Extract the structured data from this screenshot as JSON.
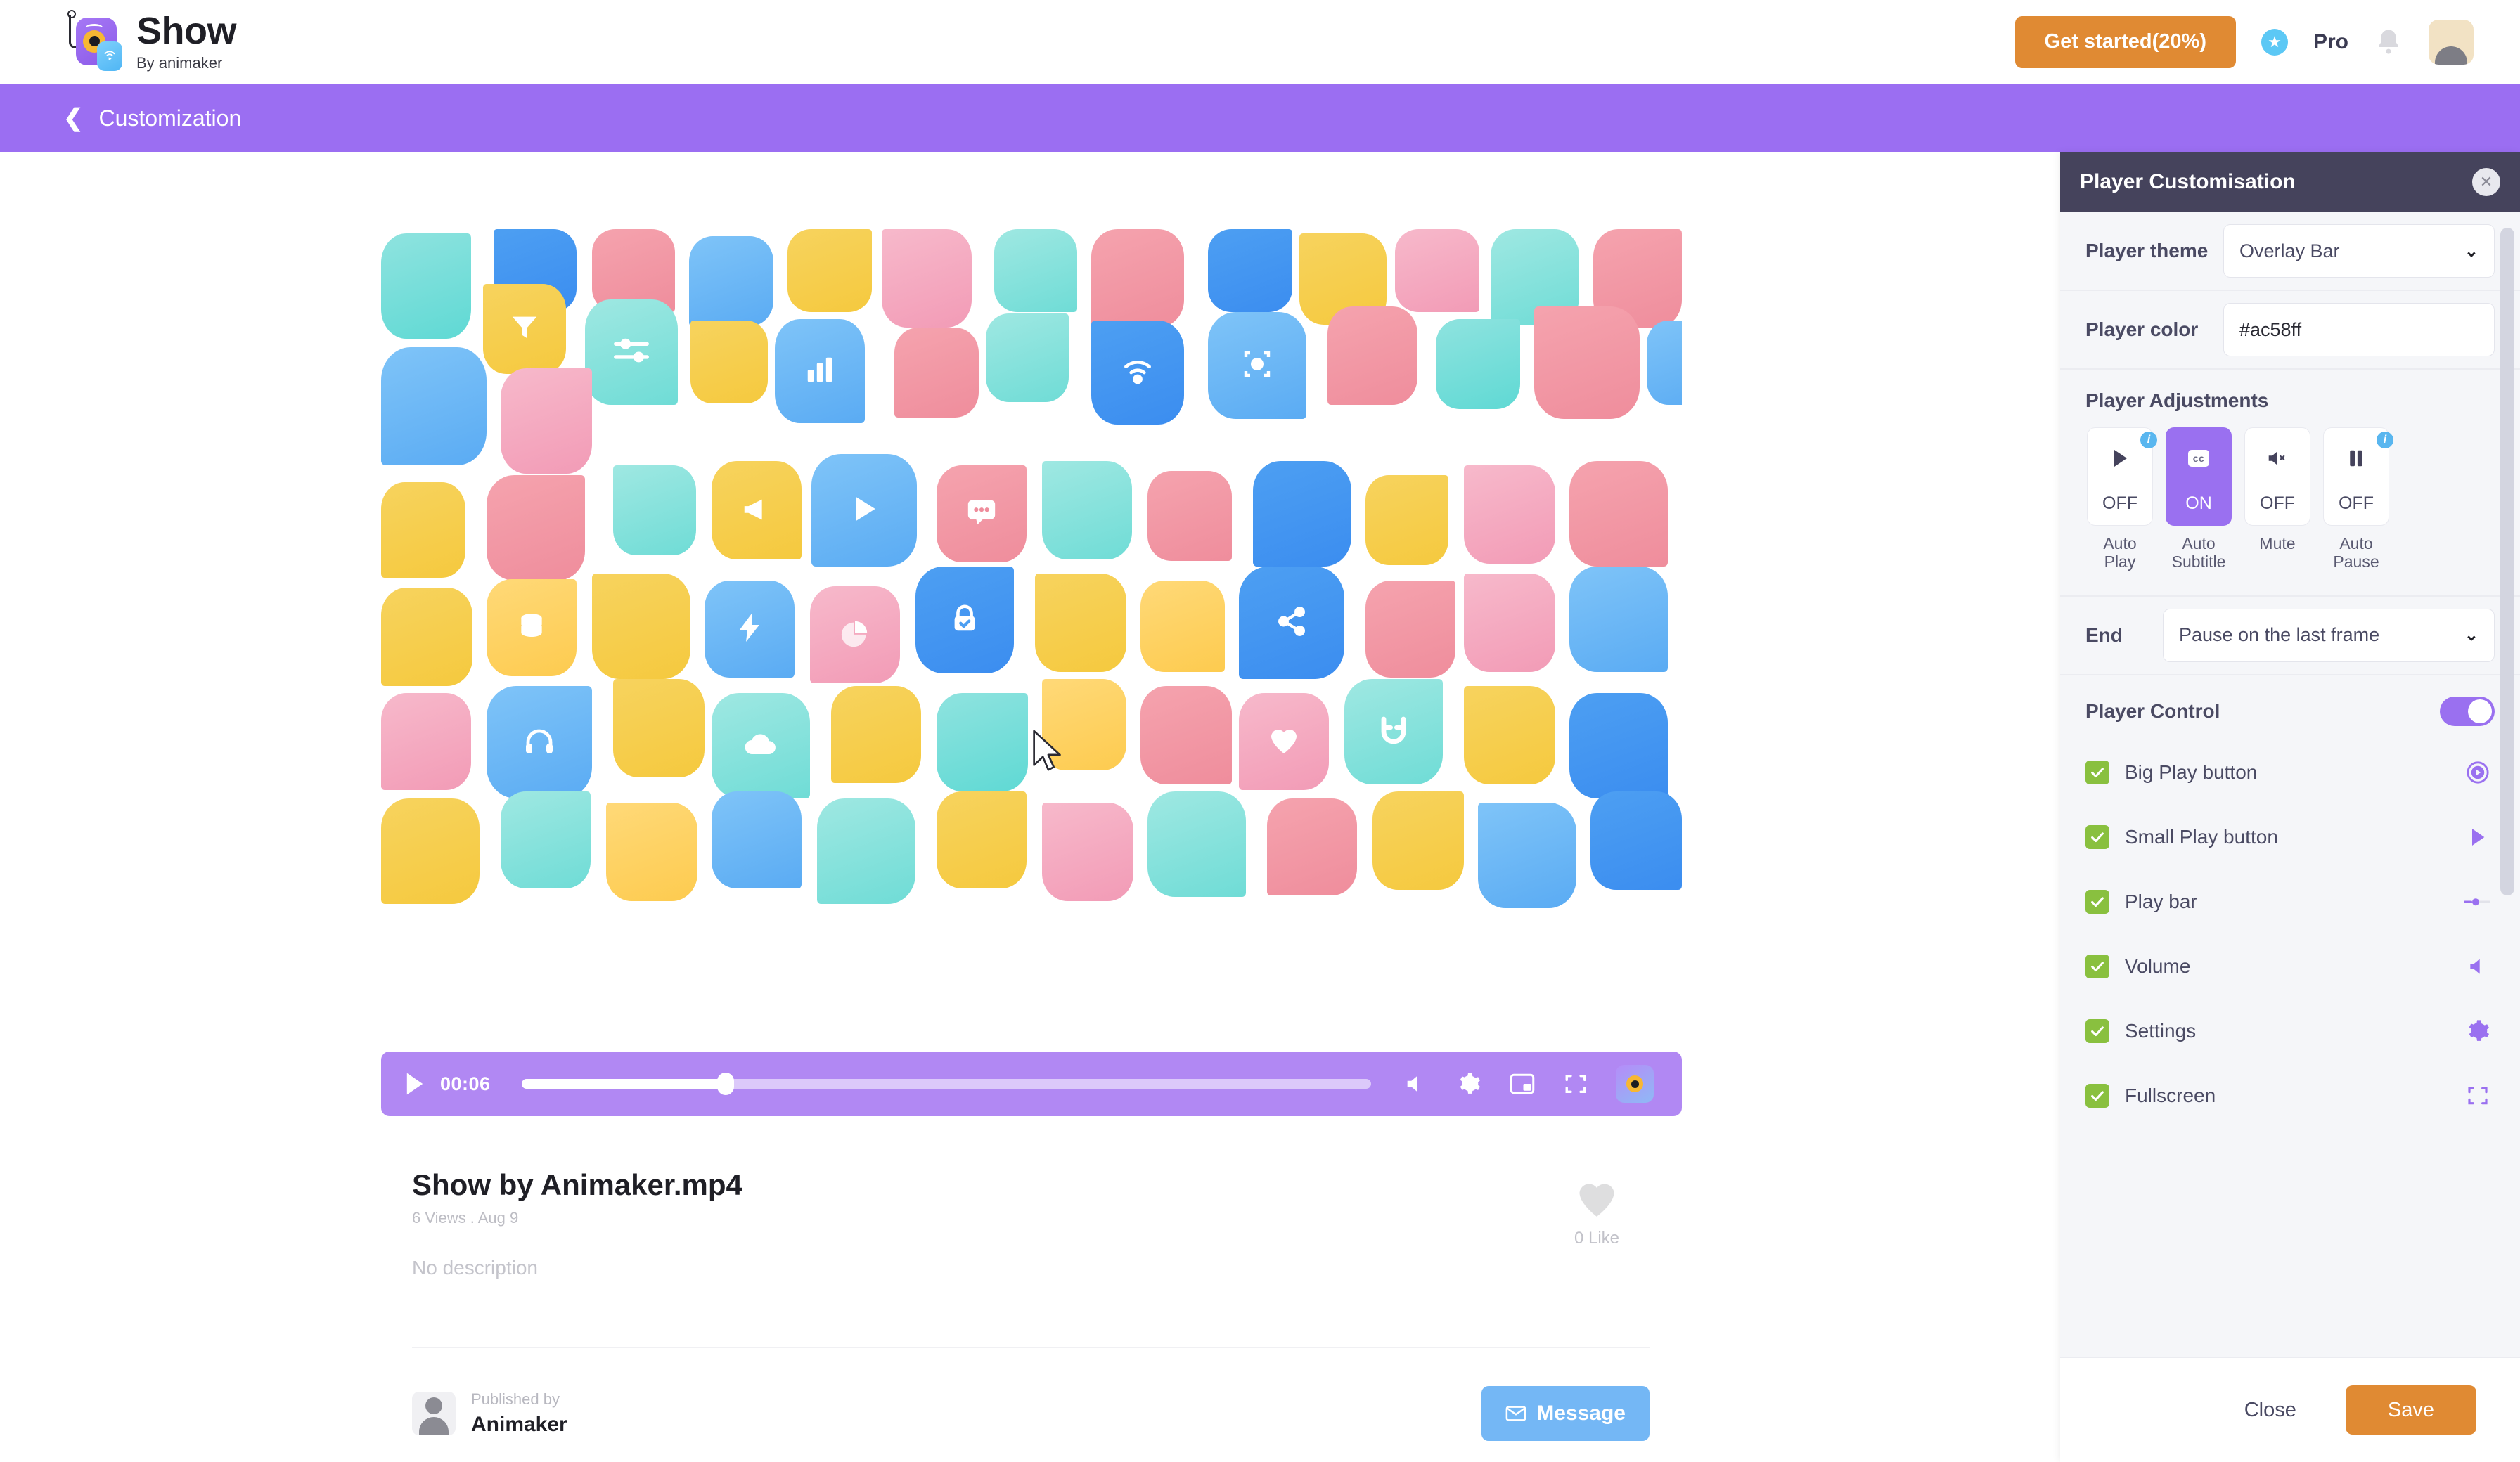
{
  "topbar": {
    "logo_name": "Show",
    "logo_tagline": "By animaker",
    "get_started_label": "Get started(20%)",
    "pro_label": "Pro",
    "star_icon": "star-icon",
    "bell_icon": "bell-icon",
    "avatar_icon": "user-avatar"
  },
  "breadcrumb": {
    "back_icon": "chevron-left-icon",
    "label": "Customization"
  },
  "player": {
    "time": "00:06",
    "progress_percent": 24,
    "play_icon": "play-icon",
    "volume_icon": "volume-icon",
    "settings_icon": "gear-icon",
    "pip_icon": "picture-in-picture-icon",
    "fullscreen_icon": "fullscreen-icon",
    "brand_icon": "show-logo-badge",
    "bar_color": "#a06ef0"
  },
  "video_meta": {
    "title": "Show by Animaker.mp4",
    "stats": "6 Views . Aug 9",
    "description": "No description",
    "like_count": "0 Like",
    "like_icon": "heart-icon",
    "published_by_label": "Published by",
    "publisher_name": "Animaker",
    "message_label": "Message",
    "message_icon": "envelope-icon"
  },
  "panel": {
    "title": "Player Customisation",
    "close_icon": "close-icon",
    "theme": {
      "label": "Player theme",
      "value": "Overlay Bar",
      "chevron": "chevron-down-icon"
    },
    "color": {
      "label": "Player color",
      "value": "#ac58ff",
      "placeholder": "#ffffff",
      "swatch": "#ac58ff"
    },
    "adjustments": {
      "heading": "Player Adjustments",
      "items": [
        {
          "name": "Auto Play",
          "state": "OFF",
          "on": false,
          "icon": "play-icon",
          "info": true
        },
        {
          "name": "Auto Subtitle",
          "state": "ON",
          "on": true,
          "icon": "cc-icon",
          "info": false
        },
        {
          "name": "Mute",
          "state": "OFF",
          "on": false,
          "icon": "volume-mute-icon",
          "info": false
        },
        {
          "name": "Auto Pause",
          "state": "OFF",
          "on": false,
          "icon": "pause-icon",
          "info": true
        }
      ]
    },
    "end": {
      "label": "End",
      "value": "Pause on the last frame",
      "chevron": "chevron-down-icon"
    },
    "player_control": {
      "title": "Player Control",
      "enabled": true,
      "items": [
        {
          "label": "Big Play button",
          "checked": true,
          "icon": "big-play-icon"
        },
        {
          "label": "Small Play button",
          "checked": true,
          "icon": "play-icon"
        },
        {
          "label": "Play bar",
          "checked": true,
          "icon": "play-bar-icon"
        },
        {
          "label": "Volume",
          "checked": true,
          "icon": "volume-icon"
        },
        {
          "label": "Settings",
          "checked": true,
          "icon": "gear-icon"
        },
        {
          "label": "Fullscreen",
          "checked": true,
          "icon": "fullscreen-icon"
        }
      ]
    },
    "footer": {
      "close_label": "Close",
      "save_label": "Save"
    }
  },
  "colors": {
    "brand_purple": "#9a70f0",
    "accent_orange": "#e08a33",
    "panel_header": "#45435c",
    "check_green": "#89c03f",
    "info_blue": "#59b6ef",
    "message_blue": "#74b7f5"
  }
}
